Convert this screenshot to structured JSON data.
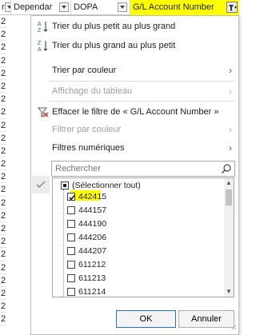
{
  "header": {
    "col_dependant": "Dependar",
    "col_dopa": "DOPA",
    "col_gl": "G/L Account Number",
    "lead_char": "r"
  },
  "rows_left": [
    "2",
    "2",
    "2",
    "2",
    "2",
    "2",
    "2",
    "2",
    "2",
    "2",
    "2",
    "2",
    "2",
    "2",
    "2",
    "2",
    "2",
    "2",
    "2",
    "2",
    "2",
    "2",
    "2",
    "2"
  ],
  "menu": {
    "sort_asc": "Trier du plus petit au plus grand",
    "sort_desc": "Trier du plus grand au plus petit",
    "sort_color": "Trier par couleur",
    "sheet_view": "Affichage du tableau",
    "clear_filter": "Effacer le filtre de « G/L Account Number »",
    "filter_color": "Filtrer par couleur",
    "number_filters": "Filtres numériques"
  },
  "search": {
    "placeholder": "Rechercher"
  },
  "list": {
    "select_all": "(Sélectionner tout)",
    "items": [
      {
        "label": "442415",
        "checked": true
      },
      {
        "label": "444157",
        "checked": false
      },
      {
        "label": "444190",
        "checked": false
      },
      {
        "label": "444206",
        "checked": false
      },
      {
        "label": "444207",
        "checked": false
      },
      {
        "label": "611212",
        "checked": false
      },
      {
        "label": "611213",
        "checked": false
      },
      {
        "label": "611214",
        "checked": false
      }
    ]
  },
  "buttons": {
    "ok": "OK",
    "cancel": "Annuler"
  },
  "colors": {
    "highlight": "#ffff00",
    "accent": "#2a6fd6",
    "filter_icon": "#c0392b"
  }
}
